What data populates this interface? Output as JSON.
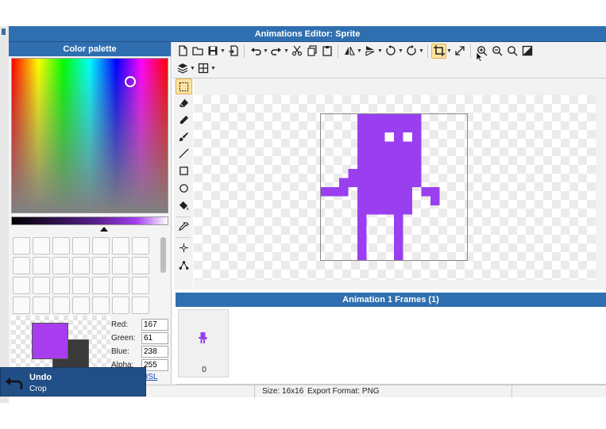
{
  "window": {
    "title": "Animations Editor: Sprite"
  },
  "palette": {
    "header": "Color palette",
    "red_label": "Red:",
    "red_value": "167",
    "green_label": "Green:",
    "green_value": "61",
    "blue_label": "Blue:",
    "blue_value": "238",
    "alpha_label": "Alpha:",
    "alpha_value": "255",
    "hsl_link": "HSL",
    "foreground_color": "#a73dee",
    "background_color": "#3a3a3a"
  },
  "toolbar": {
    "row1_icons": [
      "new-file-icon",
      "open-folder-icon",
      "save-icon",
      "export-icon",
      "undo-icon",
      "redo-icon",
      "cut-icon",
      "copy-icon",
      "paste-icon",
      "flip-horizontal-icon",
      "flip-vertical-icon",
      "rotate-left-icon",
      "rotate-right-icon",
      "crop-icon",
      "resize-icon",
      "zoom-in-icon",
      "zoom-out-icon",
      "zoom-fit-icon",
      "actual-size-icon"
    ],
    "row2_icons": [
      "layers-icon",
      "grid-icon"
    ]
  },
  "tools": [
    "select-rect-icon",
    "eraser-icon",
    "pencil-icon",
    "brush-icon",
    "line-icon",
    "rectangle-icon",
    "ellipse-icon",
    "fill-bucket-icon",
    "eyedropper-icon",
    "move-icon",
    "transform-icon"
  ],
  "canvas": {
    "sprite_color": "#9a3ff0"
  },
  "frames": {
    "header": "Animation 1 Frames (1)",
    "items": [
      {
        "number": "0"
      }
    ]
  },
  "status": {
    "size": "Size: 16x16",
    "export_format": "Export Format: PNG"
  },
  "undo_toast": {
    "title": "Undo",
    "subtitle": "Crop"
  }
}
